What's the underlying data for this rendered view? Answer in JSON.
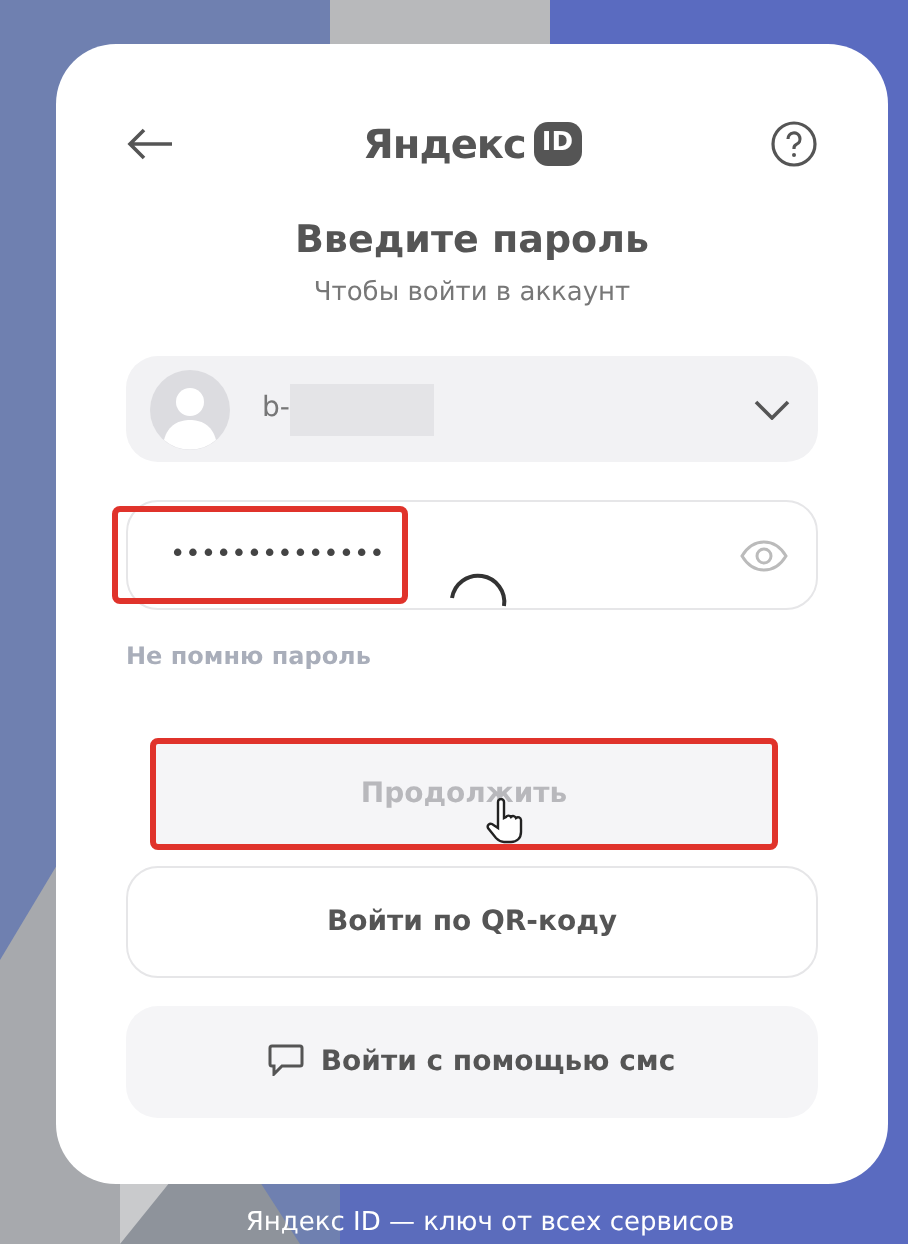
{
  "header": {
    "logo_text": "Яндекс",
    "logo_badge": "ID"
  },
  "title": "Введите пароль",
  "subtitle": "Чтобы войти в аккаунт",
  "account": {
    "login": "b-",
    "redacted": true
  },
  "password": {
    "value": "••••••••••••••",
    "highlighted": true,
    "loading": true
  },
  "forgot_link": "Не помню пароль",
  "buttons": [
    {
      "kind": "primary",
      "label": "Продолжить",
      "disabled": true,
      "highlighted": true,
      "hovered": true
    },
    {
      "kind": "outline",
      "label": "Войти по QR-коду",
      "disabled": false,
      "highlighted": false,
      "hovered": false
    },
    {
      "kind": "sms",
      "label": "Войти с помощью смс",
      "disabled": false,
      "highlighted": false,
      "hovered": false
    }
  ],
  "footer": "Яндекс ID — ключ от всех сервисов"
}
